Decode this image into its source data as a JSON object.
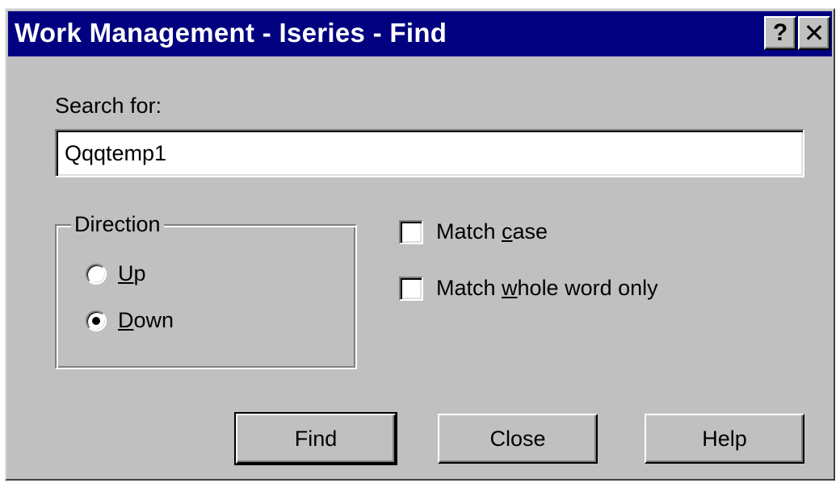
{
  "window": {
    "title": "Work Management - Iseries - Find",
    "help_glyph": "?",
    "close_glyph": "✕"
  },
  "search": {
    "label": "Search for:",
    "value": "Qqqtemp1"
  },
  "direction": {
    "title": "Direction",
    "up": {
      "pre": "",
      "accel": "U",
      "post": "p",
      "selected": false
    },
    "down": {
      "pre": "",
      "accel": "D",
      "post": "own",
      "selected": true
    }
  },
  "options": {
    "match_case": {
      "pre": "Match ",
      "accel": "c",
      "post": "ase",
      "checked": false
    },
    "match_whole": {
      "pre": "Match ",
      "accel": "w",
      "post": "hole word only",
      "checked": false
    }
  },
  "buttons": {
    "find": "Find",
    "close": "Close",
    "help": "Help"
  },
  "icons": {
    "help": "question-mark-icon",
    "close": "close-x-icon"
  },
  "colors": {
    "titlebar": "#000080",
    "face": "#c0c0c0"
  }
}
